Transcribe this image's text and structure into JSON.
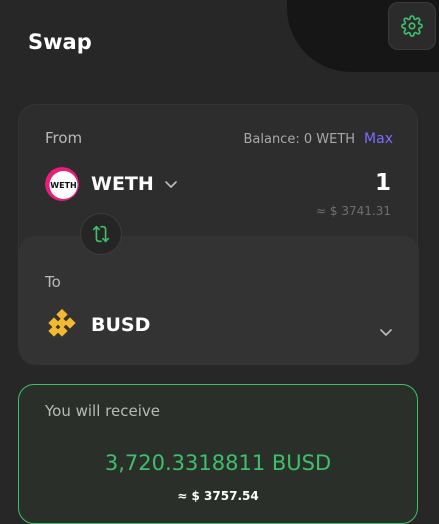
{
  "header": {
    "title": "Swap",
    "settings_icon": "gear-icon"
  },
  "from": {
    "label": "From",
    "balance_text": "Balance: 0 WETH",
    "max_label": "Max",
    "token_symbol": "WETH",
    "token_icon_text": "WETH",
    "amount": "1",
    "usd_value": "≈ $ 3741.31"
  },
  "swap_icon": "swap-arrows-icon",
  "to": {
    "label": "To",
    "token_symbol": "BUSD"
  },
  "receive": {
    "label": "You will receive",
    "amount": "3,720.3318811 BUSD",
    "usd_value": "≈ $ 3757.54"
  },
  "colors": {
    "accent_green": "#3fbf6b",
    "max_link": "#7b6cff",
    "busd_yellow": "#f3ba2f",
    "weth_pink": "#ec1c79"
  }
}
